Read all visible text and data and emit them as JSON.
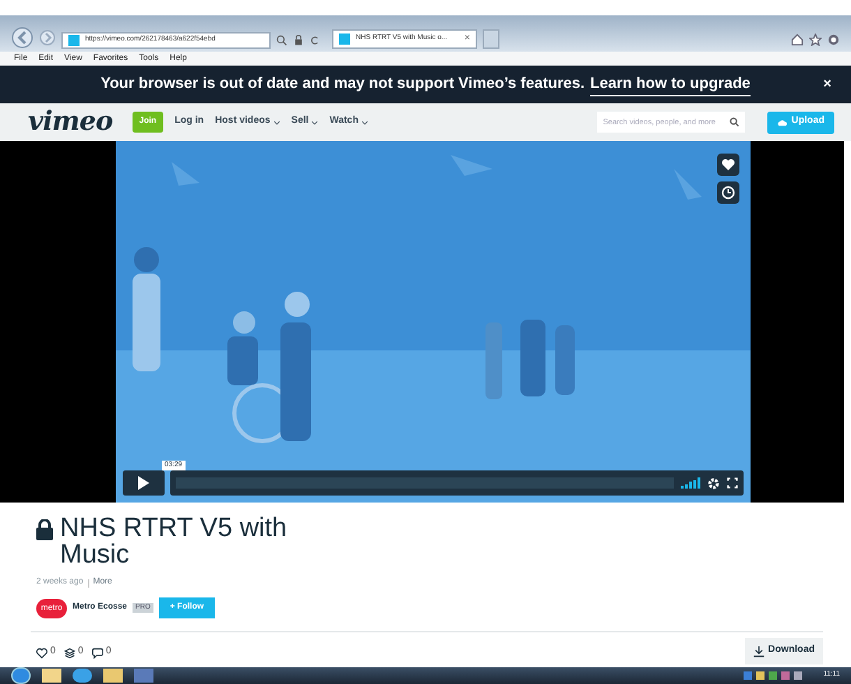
{
  "browser": {
    "url": "https://vimeo.com/262178463/a622f54ebd",
    "tab_title": "NHS RTRT V5 with Music o...",
    "tab_close": "×",
    "menu": [
      "File",
      "Edit",
      "View",
      "Favorites",
      "Tools",
      "Help"
    ]
  },
  "banner": {
    "text": "Your browser is out of date and may not support Vimeo’s features.",
    "link": "Learn how to upgrade",
    "close": "×"
  },
  "nav": {
    "logo": "vimeo",
    "join": "Join",
    "links": [
      {
        "label": "Log in",
        "dropdown": false
      },
      {
        "label": "Host videos",
        "dropdown": true
      },
      {
        "label": "Sell",
        "dropdown": true
      },
      {
        "label": "Watch",
        "dropdown": true
      }
    ],
    "search": {
      "placeholder": "Search videos, people, and more"
    },
    "upload": "Upload"
  },
  "player": {
    "kind": "picture",
    "time": "03:29"
  },
  "video": {
    "title": "NHS RTRT V5 with Music",
    "private": true,
    "posted": "2 weeks ago",
    "more": "More",
    "owner": {
      "avatar": "metro",
      "name": "Metro Ecosse",
      "badge": "PRO",
      "follow": "+ Follow"
    }
  },
  "stats": [
    {
      "kind": "like",
      "count": "0"
    },
    {
      "kind": "collection",
      "count": "0"
    },
    {
      "kind": "comment",
      "count": "0"
    }
  ],
  "download": "Download",
  "taskbar": {
    "clock": "11:11"
  }
}
